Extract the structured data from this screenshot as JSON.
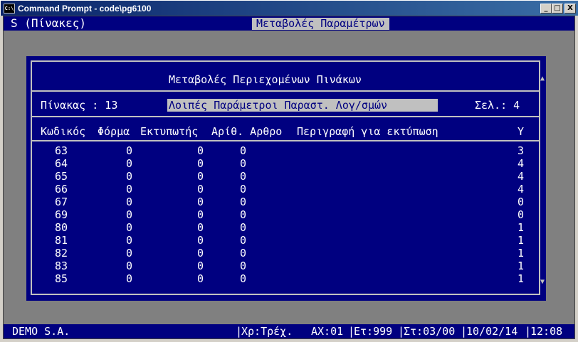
{
  "window": {
    "title": "Command Prompt - code\\pg6100",
    "icon_label": "C:\\",
    "buttons": {
      "minimize": "_",
      "maximize": "□",
      "close": "X"
    }
  },
  "topbar": {
    "left": "S (Πίνακες)",
    "center": "Μεταβολές Παραμέτρων"
  },
  "panel": {
    "title": "Μεταβολές Περιεχομένων Πινάκων",
    "table_label": "Πίνακας : 13",
    "table_name": "Λοιπές Παράμετροι Παραστ. Λογ/σμών",
    "page_label": "Σελ.: 4",
    "headers": {
      "code": "Κωδικός",
      "form": "Φόρμα",
      "printer": "Εκτυπωτής",
      "article": "Αρίθ. Αρθρο",
      "description": "Περιγραφή για εκτύπωση",
      "y": "Υ"
    },
    "rows": [
      {
        "code": "63",
        "form": "0",
        "printer": "0",
        "article": "0",
        "y": "3"
      },
      {
        "code": "64",
        "form": "0",
        "printer": "0",
        "article": "0",
        "y": "4"
      },
      {
        "code": "65",
        "form": "0",
        "printer": "0",
        "article": "0",
        "y": "4"
      },
      {
        "code": "66",
        "form": "0",
        "printer": "0",
        "article": "0",
        "y": "4"
      },
      {
        "code": "67",
        "form": "0",
        "printer": "0",
        "article": "0",
        "y": "0"
      },
      {
        "code": "69",
        "form": "0",
        "printer": "0",
        "article": "0",
        "y": "0"
      },
      {
        "code": "80",
        "form": "0",
        "printer": "0",
        "article": "0",
        "y": "1"
      },
      {
        "code": "81",
        "form": "0",
        "printer": "0",
        "article": "0",
        "y": "1"
      },
      {
        "code": "82",
        "form": "0",
        "printer": "0",
        "article": "0",
        "y": "1"
      },
      {
        "code": "83",
        "form": "0",
        "printer": "0",
        "article": "0",
        "y": "1"
      },
      {
        "code": "85",
        "form": "0",
        "printer": "0",
        "article": "0",
        "y": "1"
      }
    ],
    "scroll_up_icon": "▲",
    "scroll_down_icon": "▼"
  },
  "statusbar": {
    "company": "DEMO S.A.",
    "mode": "Χρ:Τρέχ.",
    "ax": "ΑΧ:01",
    "et": "Ετ:999",
    "st": "Στ:03/00",
    "date": "10/02/14",
    "time": "12:08"
  }
}
